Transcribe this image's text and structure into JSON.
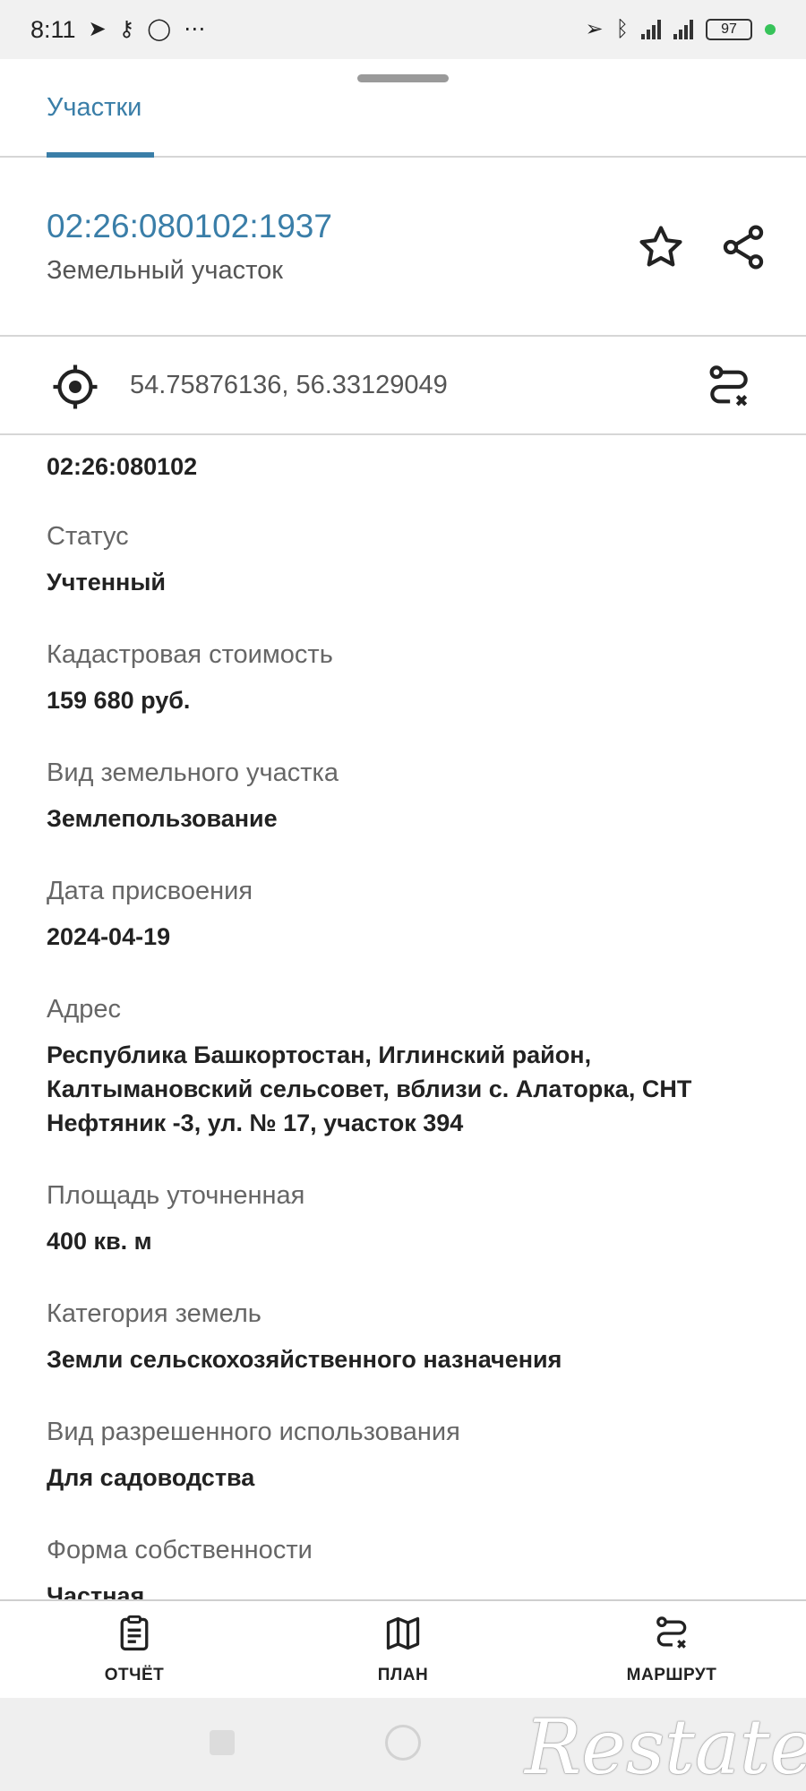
{
  "status_bar": {
    "time": "8:11",
    "battery": "97"
  },
  "tabs": [
    {
      "label": "Участки"
    }
  ],
  "header": {
    "cadastral_number": "02:26:080102:1937",
    "object_type": "Земельный участок"
  },
  "location": {
    "coordinates": "54.75876136, 56.33129049"
  },
  "details": {
    "quarter": "02:26:080102",
    "fields": [
      {
        "label": "Статус",
        "value": "Учтенный"
      },
      {
        "label": "Кадастровая стоимость",
        "value": "159 680 руб."
      },
      {
        "label": "Вид земельного участка",
        "value": "Землепользование"
      },
      {
        "label": "Дата присвоения",
        "value": "2024-04-19"
      },
      {
        "label": "Адрес",
        "value": "Республика Башкортостан, Иглинский район, Калтымановский сельсовет, вблизи с. Алаторка, СНТ Нефтяник -3, ул. № 17, участок 394"
      },
      {
        "label": "Площадь уточненная",
        "value": "400 кв. м"
      },
      {
        "label": "Категория земель",
        "value": "Земли сельскохозяйственного назначения"
      },
      {
        "label": "Вид разрешенного использования",
        "value": "Для садоводства"
      },
      {
        "label": "Форма собственности",
        "value": "Частная"
      }
    ]
  },
  "bottom_bar": {
    "report": "ОТЧЁТ",
    "plan": "ПЛАН",
    "route": "МАРШРУТ"
  },
  "watermark": "Restate",
  "colors": {
    "accent": "#3a7ea8",
    "battery_dot": "#37c35a"
  }
}
